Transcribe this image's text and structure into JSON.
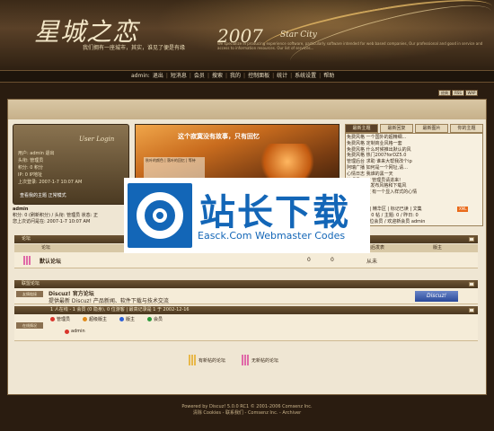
{
  "banner": {
    "logo": "星城之恋",
    "slogan": "我们拥有一座城市，其实，谁见了便是有缘",
    "year": "2007",
    "star_city": "Star City",
    "blurb": "We specialize in producing experience software, particularly software intended for web based companies, Our professional and good in service and access to information resources. Our list of services..."
  },
  "nav": {
    "user": "admin:",
    "items": [
      "退出",
      "短消息",
      "会员",
      "搜索",
      "我的",
      "控制面板",
      "统计",
      "系统设置",
      "帮助"
    ]
  },
  "mini_icons": [
    "经典",
    "RSS",
    "WAP"
  ],
  "login": {
    "title": "User Login",
    "rows": [
      "用户: admin 退出",
      "头衔: 管理员",
      "积分: 0 积分",
      "IP: 0 IP地址",
      "上次登录: 2007-1-7 10:07 AM"
    ],
    "myposts": "查看我的主题",
    "myposts_link": "正常模式"
  },
  "photo": {
    "caption": "这个寂寞没有故事，只有回忆",
    "poem": "秋叶的颜色 | 落叶的回忆 | 等待"
  },
  "news": {
    "tabs": [
      "最新主题",
      "最新回复",
      "最新图片",
      "你的主题"
    ],
    "items": [
      "免费风格 一个国外的超精细...",
      "免费风格 定制商业风格一套",
      "免费风格 什么时候推出默认的风",
      "免费风格 热门2007forDZ5.0",
      "管理后台 求助 谁来大帮我改个ip",
      "阿瑞广播 如何是一个网址,请...",
      "心情日志 我谁的黑一天",
      "管理员 一下 管理员请进来!",
      "风格 2模板 发布风格和下载风",
      "免费风格 蓝 有一个显入样式的心情",
      "...",
      "..."
    ]
  },
  "userinfo": {
    "name": "admin",
    "line1": "积分: 0 (刷新积分) / 头衔: 管理员  状态: 正",
    "line2": "您上次访问是在: 2007-1-7 10:07 AM"
  },
  "right_links": "新帖 | 精华区 | 标记已读 | 文集",
  "right_links2": "共 1 位会员 / 欢迎新会员 admin",
  "right_counts": "今日: 0 帖 / 主题: 0 / 昨日: 0",
  "xml": "XML",
  "category1": {
    "title": "论坛",
    "columns": [
      "论坛",
      "主题",
      "帖数",
      "最后发表",
      "版主"
    ],
    "forum": {
      "name": "默认论坛",
      "topics": "0",
      "posts": "0",
      "last": "从未"
    }
  },
  "category2": {
    "title": "联盟论坛",
    "label": "友情链接",
    "name": "Discuz! 官方论坛",
    "desc": "提供最新 Discuz! 产品新闻、软件下载与技术交流",
    "badge": "Discuz!"
  },
  "online": {
    "label": "在线情况",
    "summary": "1 人在线 - 1 会员 (0 隐身), 0 位游客 | 最高记录是 1 于 2002-12-16",
    "legend": [
      "管理员",
      "超级版主",
      "版主",
      "会员"
    ],
    "legend_colors": [
      "#d9342b",
      "#e08a1a",
      "#2b5fd9",
      "#2b9a3a"
    ],
    "user": "admin"
  },
  "bottom_legend": [
    "有新帖的论坛",
    "无新帖的论坛"
  ],
  "footer": {
    "line1": "Powered by Discuz! 5.0.0 RC1 © 2001-2006 Comsenz Inc.",
    "line2": "清除 Cookies - 联系我们 - Comsenz Inc. - Archiver"
  },
  "watermark": {
    "title": "站长下载",
    "sub": "Easck.Com Webmaster Codes"
  }
}
